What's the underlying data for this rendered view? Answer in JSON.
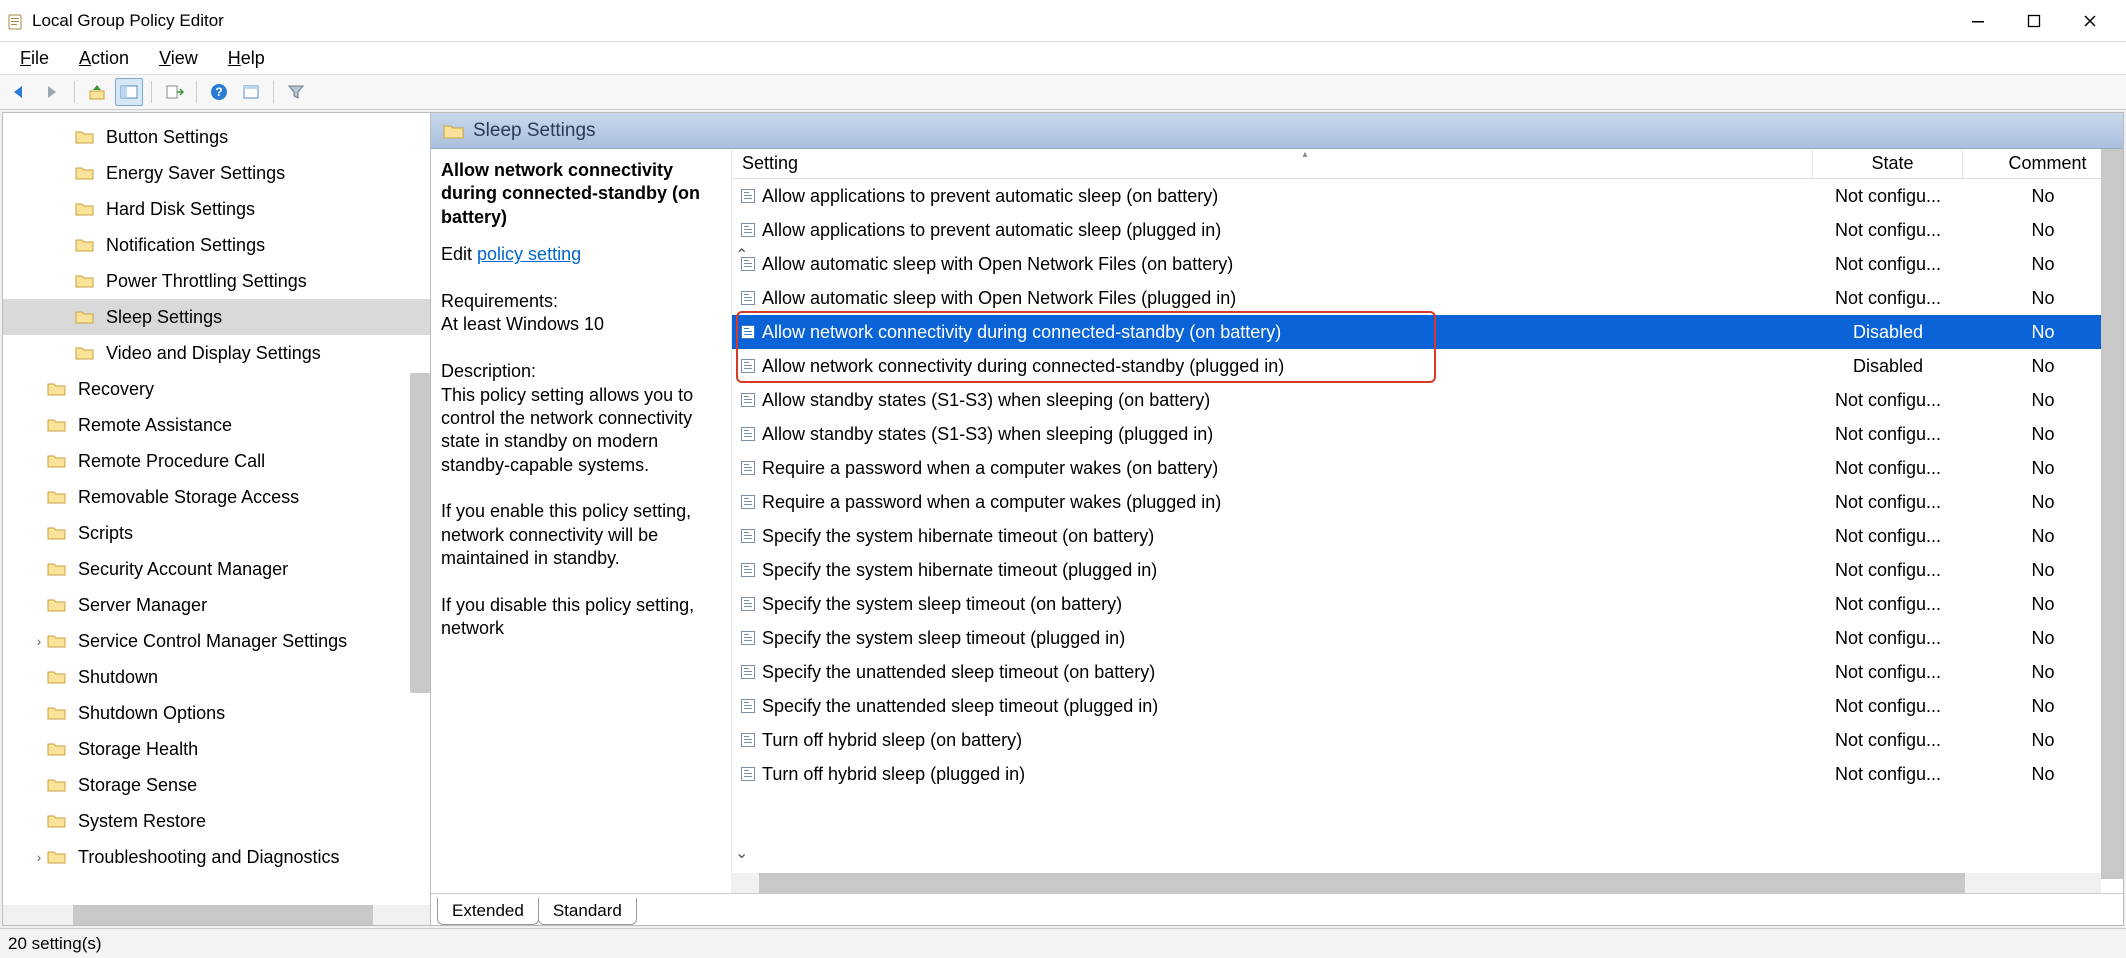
{
  "window": {
    "title": "Local Group Policy Editor"
  },
  "menubar": [
    "File",
    "Action",
    "View",
    "Help"
  ],
  "tree": [
    {
      "label": "Button Settings",
      "indent": 2,
      "exp": ""
    },
    {
      "label": "Energy Saver Settings",
      "indent": 2,
      "exp": ""
    },
    {
      "label": "Hard Disk Settings",
      "indent": 2,
      "exp": ""
    },
    {
      "label": "Notification Settings",
      "indent": 2,
      "exp": ""
    },
    {
      "label": "Power Throttling Settings",
      "indent": 2,
      "exp": ""
    },
    {
      "label": "Sleep Settings",
      "indent": 2,
      "exp": "",
      "selected": true
    },
    {
      "label": "Video and Display Settings",
      "indent": 2,
      "exp": ""
    },
    {
      "label": "Recovery",
      "indent": 1,
      "exp": ""
    },
    {
      "label": "Remote Assistance",
      "indent": 1,
      "exp": ""
    },
    {
      "label": "Remote Procedure Call",
      "indent": 1,
      "exp": ""
    },
    {
      "label": "Removable Storage Access",
      "indent": 1,
      "exp": ""
    },
    {
      "label": "Scripts",
      "indent": 1,
      "exp": ""
    },
    {
      "label": "Security Account Manager",
      "indent": 1,
      "exp": ""
    },
    {
      "label": "Server Manager",
      "indent": 1,
      "exp": ""
    },
    {
      "label": "Service Control Manager Settings",
      "indent": 1,
      "exp": ">"
    },
    {
      "label": "Shutdown",
      "indent": 1,
      "exp": ""
    },
    {
      "label": "Shutdown Options",
      "indent": 1,
      "exp": ""
    },
    {
      "label": "Storage Health",
      "indent": 1,
      "exp": ""
    },
    {
      "label": "Storage Sense",
      "indent": 1,
      "exp": ""
    },
    {
      "label": "System Restore",
      "indent": 1,
      "exp": ""
    },
    {
      "label": "Troubleshooting and Diagnostics",
      "indent": 1,
      "exp": ">"
    }
  ],
  "right": {
    "header": "Sleep Settings",
    "desc_title": "Allow network connectivity during connected-standby (on battery)",
    "edit_label": "Edit ",
    "edit_link": "policy setting ",
    "req_label": "Requirements:",
    "req_text": "At least Windows 10",
    "desc_label": "Description:",
    "desc_p1": "This policy setting allows you to control the network connectivity state in standby on modern standby-capable systems.",
    "desc_p2": "If you enable this policy setting, network connectivity will be maintained in standby.",
    "desc_p3": "If you disable this policy setting, network",
    "cols": {
      "setting": "Setting",
      "state": "State",
      "comment": "Comment"
    },
    "rows": [
      {
        "s": "Allow applications to prevent automatic sleep (on battery)",
        "st": "Not configu...",
        "c": "No"
      },
      {
        "s": "Allow applications to prevent automatic sleep (plugged in)",
        "st": "Not configu...",
        "c": "No"
      },
      {
        "s": "Allow automatic sleep with Open Network Files (on battery)",
        "st": "Not configu...",
        "c": "No"
      },
      {
        "s": "Allow automatic sleep with Open Network Files (plugged in)",
        "st": "Not configu...",
        "c": "No"
      },
      {
        "s": "Allow network connectivity during connected-standby (on battery)",
        "st": "Disabled",
        "c": "No",
        "sel": true
      },
      {
        "s": "Allow network connectivity during connected-standby (plugged in)",
        "st": "Disabled",
        "c": "No"
      },
      {
        "s": "Allow standby states (S1-S3) when sleeping (on battery)",
        "st": "Not configu...",
        "c": "No"
      },
      {
        "s": "Allow standby states (S1-S3) when sleeping (plugged in)",
        "st": "Not configu...",
        "c": "No"
      },
      {
        "s": "Require a password when a computer wakes (on battery)",
        "st": "Not configu...",
        "c": "No"
      },
      {
        "s": "Require a password when a computer wakes (plugged in)",
        "st": "Not configu...",
        "c": "No"
      },
      {
        "s": "Specify the system hibernate timeout (on battery)",
        "st": "Not configu...",
        "c": "No"
      },
      {
        "s": "Specify the system hibernate timeout (plugged in)",
        "st": "Not configu...",
        "c": "No"
      },
      {
        "s": "Specify the system sleep timeout (on battery)",
        "st": "Not configu...",
        "c": "No"
      },
      {
        "s": "Specify the system sleep timeout (plugged in)",
        "st": "Not configu...",
        "c": "No"
      },
      {
        "s": "Specify the unattended sleep timeout (on battery)",
        "st": "Not configu...",
        "c": "No"
      },
      {
        "s": "Specify the unattended sleep timeout (plugged in)",
        "st": "Not configu...",
        "c": "No"
      },
      {
        "s": "Turn off hybrid sleep (on battery)",
        "st": "Not configu...",
        "c": "No"
      },
      {
        "s": "Turn off hybrid sleep (plugged in)",
        "st": "Not configu...",
        "c": "No"
      }
    ],
    "tabs": [
      "Extended",
      "Standard"
    ]
  },
  "statusbar": "20 setting(s)"
}
